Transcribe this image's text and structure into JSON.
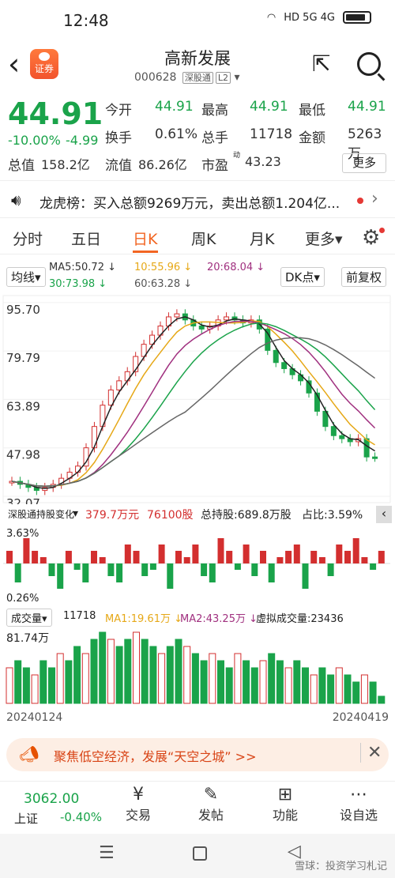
{
  "status": {
    "time": "12:48",
    "signal": "HD 5G 4G"
  },
  "header": {
    "title": "高新发展",
    "code": "000628",
    "market": "深股通",
    "level": "L2",
    "logo_text": "证券"
  },
  "quote": {
    "price": "44.91",
    "pct": "-10.00%",
    "change": "-4.99"
  },
  "grid": [
    {
      "l": "今开",
      "v": "44.91"
    },
    {
      "l": "最高",
      "v": "44.91"
    },
    {
      "l": "最低",
      "v": "44.91"
    },
    {
      "l": "换手",
      "v": "0.61%"
    },
    {
      "l": "总手",
      "v": "11718"
    },
    {
      "l": "金额",
      "v": "5263万"
    },
    {
      "l": "总值",
      "v": "158.2亿"
    },
    {
      "l": "流值",
      "v": "86.26亿"
    },
    {
      "l": "市盈",
      "v": "43.23",
      "sup": "动"
    }
  ],
  "more": "更多",
  "lhb": {
    "text": "龙虎榜：买入总额9269万元，卖出总额1.204亿..."
  },
  "tabs": [
    "分时",
    "五日",
    "日K",
    "周K",
    "月K",
    "更多"
  ],
  "ma": {
    "btn": "均线",
    "ma5": "MA5:50.72",
    "ma10": "10:55.96",
    "ma20": "20:68.04",
    "ma30": "30:73.98",
    "ma60": "60:63.28",
    "dk": "DK点",
    "fq": "前复权"
  },
  "chart_data": {
    "type": "candlestick",
    "ytick": [
      "95.70",
      "79.79",
      "63.89",
      "47.98",
      "32.07"
    ],
    "closes": [
      37,
      36,
      35,
      34,
      35,
      36,
      38,
      40,
      42,
      48,
      55,
      62,
      67,
      70,
      73,
      78,
      82,
      85,
      88,
      91,
      92,
      90,
      88,
      87,
      88,
      90,
      91,
      90,
      89,
      90,
      87,
      80,
      76,
      74,
      72,
      70,
      66,
      60,
      55,
      52,
      51,
      50,
      51,
      45,
      44.91
    ]
  },
  "hold": {
    "title": "深股通持股变化",
    "amount": "379.7万元",
    "shares": "76100股",
    "total": "总持股:689.8万股",
    "ratio": "占比:3.59%",
    "hi": "3.63%",
    "lo": "0.26%"
  },
  "vol": {
    "title": "成交量",
    "val": "11718",
    "ma1": "MA1:19.61万",
    "ma2": "MA2:43.25万",
    "virt": "虚拟成交量:23436",
    "max": "81.74万",
    "d1": "20240124",
    "d2": "20240419"
  },
  "banner": "聚焦低空经济，发展“天空之城” >>",
  "bottom": {
    "index": "3062.00",
    "iname": "上证",
    "ipct": "-0.40%",
    "items": [
      "交易",
      "发帖",
      "功能",
      "设自选"
    ]
  },
  "watermark": "雪球：投资学习札记"
}
